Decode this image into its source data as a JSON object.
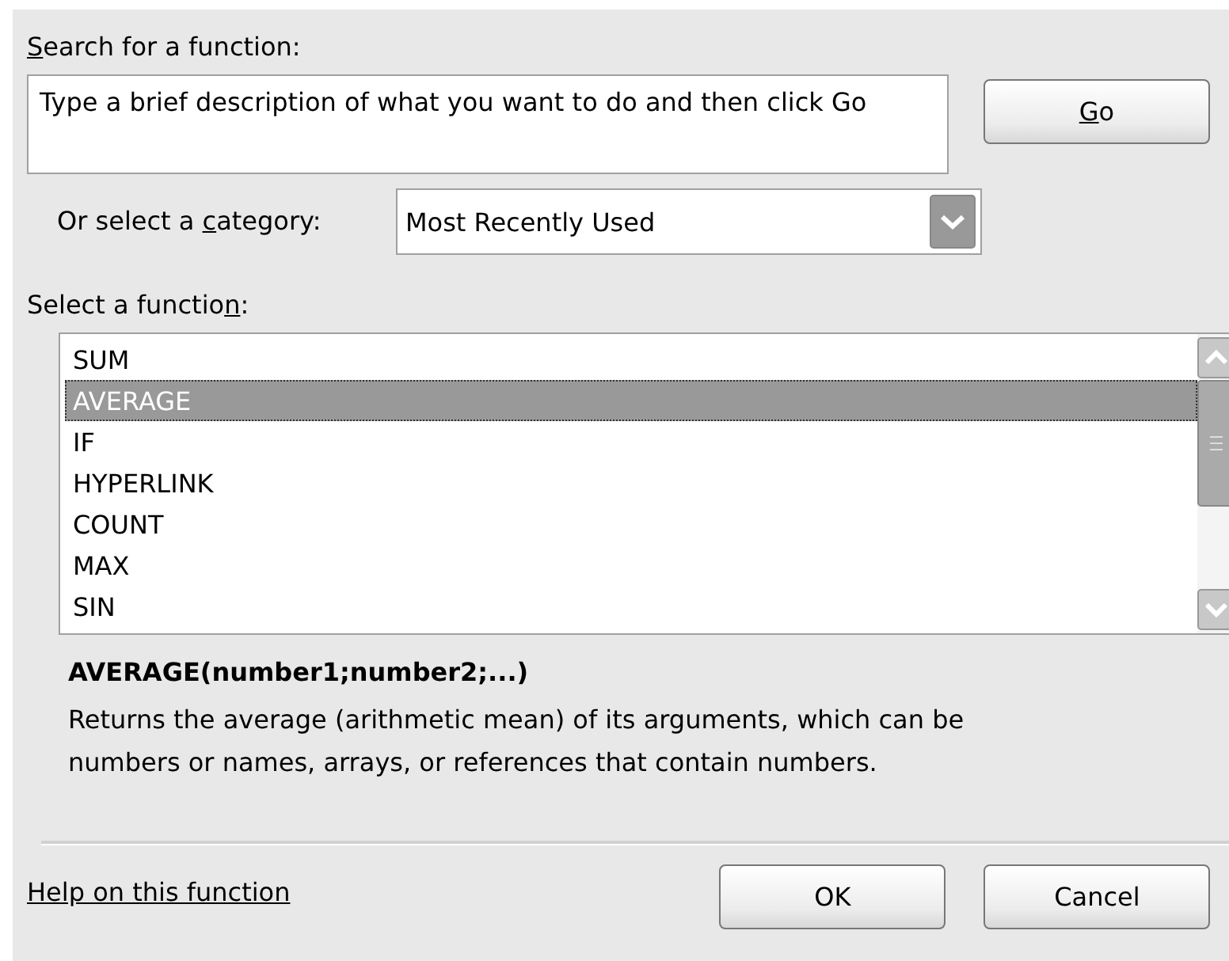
{
  "search": {
    "label": {
      "key": "S",
      "after": "earch for a function:"
    },
    "placeholder": "Type a brief description of what you want to do and then click Go",
    "go_button": {
      "key": "G",
      "after": "o"
    }
  },
  "category": {
    "label": {
      "before": "Or select a ",
      "key": "c",
      "after": "ategory:"
    },
    "value": "Most Recently Used"
  },
  "functions": {
    "label": {
      "before": "Select a functio",
      "key": "n",
      "after": ":"
    },
    "items": [
      {
        "name": "SUM",
        "selected": false
      },
      {
        "name": "AVERAGE",
        "selected": true
      },
      {
        "name": "IF",
        "selected": false
      },
      {
        "name": "HYPERLINK",
        "selected": false
      },
      {
        "name": "COUNT",
        "selected": false
      },
      {
        "name": "MAX",
        "selected": false
      },
      {
        "name": "SIN",
        "selected": false
      }
    ]
  },
  "signature": "AVERAGE(number1;number2;...)",
  "description": "Returns the average (arithmetic mean) of its arguments, which can be numbers or names, arrays, or references that contain numbers.",
  "help_link": "Help on this function",
  "buttons": [
    "OK",
    "Cancel"
  ]
}
